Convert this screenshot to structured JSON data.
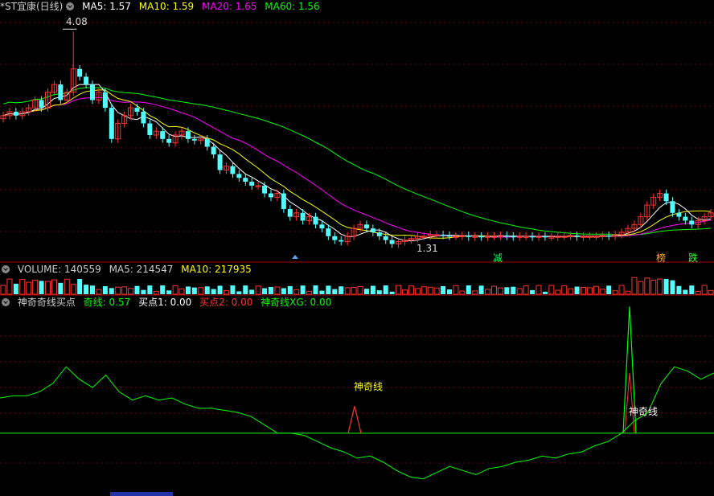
{
  "main": {
    "title": "*ST宜康(日线)",
    "ma5": "MA5: 1.57",
    "ma10": "MA10: 1.59",
    "ma20": "MA20: 1.65",
    "ma60": "MA60: 1.56",
    "high_label": "4.08",
    "low_label": "1.31",
    "tags": [
      "减",
      "榜",
      "跌"
    ]
  },
  "volume": {
    "label": "VOLUME: 140559",
    "ma5": "MA5: 214547",
    "ma10": "MA10: 217935"
  },
  "indicator": {
    "title": "神奇奇线买点",
    "qixian": "奇线: 0.57",
    "buy1": "买点1: 0.00",
    "buy2": "买点2: 0.00",
    "xg": "神奇线XG: 0.00",
    "annotation": "神奇线"
  },
  "colors": {
    "ma5": "#ffffff",
    "ma10": "#ffff00",
    "ma20": "#ff00ff",
    "ma60": "#00ff00",
    "up": "#ff3232",
    "down": "#54ffff",
    "buy2": "#ff3232",
    "xg": "#00ff00"
  },
  "chart_data": [
    {
      "type": "candlestick",
      "name": "*ST宜康(日线)",
      "ylim": [
        1.2,
        4.3
      ],
      "price_high": 4.08,
      "price_low": 1.31,
      "ma_values": {
        "MA5": 1.57,
        "MA10": 1.59,
        "MA20": 1.65,
        "MA60": 1.56
      },
      "closes": [
        3.0,
        3.05,
        3.0,
        3.05,
        3.1,
        3.2,
        3.1,
        3.3,
        3.4,
        3.2,
        3.3,
        3.6,
        3.5,
        3.4,
        3.2,
        3.3,
        3.1,
        2.7,
        2.9,
        3.0,
        3.1,
        3.05,
        2.9,
        2.75,
        2.8,
        2.7,
        2.65,
        2.75,
        2.8,
        2.7,
        2.68,
        2.7,
        2.6,
        2.5,
        2.3,
        2.35,
        2.25,
        2.2,
        2.15,
        2.1,
        2.1,
        2.0,
        1.95,
        2.0,
        1.8,
        1.7,
        1.75,
        1.65,
        1.7,
        1.6,
        1.55,
        1.45,
        1.4,
        1.38,
        1.45,
        1.55,
        1.6,
        1.55,
        1.5,
        1.45,
        1.4,
        1.35,
        1.38,
        1.4,
        1.42,
        1.45,
        1.45,
        1.47,
        1.47,
        1.46,
        1.45,
        1.45,
        1.46,
        1.44,
        1.45,
        1.44,
        1.45,
        1.45,
        1.46,
        1.45,
        1.44,
        1.45,
        1.45,
        1.44,
        1.45,
        1.44,
        1.44,
        1.45,
        1.45,
        1.46,
        1.44,
        1.45,
        1.45,
        1.45,
        1.46,
        1.45,
        1.47,
        1.5,
        1.55,
        1.6,
        1.7,
        1.85,
        1.95,
        2.0,
        1.9,
        1.75,
        1.7,
        1.65,
        1.6,
        1.65,
        1.7,
        1.75
      ]
    },
    {
      "type": "bar",
      "name": "VOLUME",
      "latest": 140559,
      "ma5": 214547,
      "ma10": 217935
    },
    {
      "type": "line",
      "name": "神奇奇线买点",
      "series": [
        {
          "name": "奇线",
          "latest": 0.57
        },
        {
          "name": "买点1",
          "latest": 0.0
        },
        {
          "name": "买点2",
          "latest": 0.0
        },
        {
          "name": "神奇线XG",
          "latest": 0.0
        }
      ],
      "qixian_values": [
        0.85,
        0.9,
        0.9,
        1.0,
        1.2,
        1.6,
        1.3,
        1.1,
        1.4,
        1.0,
        0.8,
        0.9,
        0.8,
        0.85,
        0.7,
        0.6,
        0.6,
        0.55,
        0.5,
        0.4,
        0.2,
        0.0,
        0.0,
        -0.05,
        -0.2,
        -0.35,
        -0.45,
        -0.6,
        -0.55,
        -0.7,
        -0.9,
        -1.05,
        -1.1,
        -0.95,
        -0.8,
        -0.9,
        -1.0,
        -0.85,
        -0.8,
        -0.7,
        -0.65,
        -0.55,
        -0.6,
        -0.5,
        -0.45,
        -0.3,
        -0.2,
        0.0,
        0.3,
        0.5,
        1.2,
        1.6,
        1.5,
        1.3,
        1.45
      ],
      "peaks": [
        0.65,
        1.65,
        1.45
      ],
      "ylim": [
        -1.3,
        3.0
      ]
    }
  ]
}
